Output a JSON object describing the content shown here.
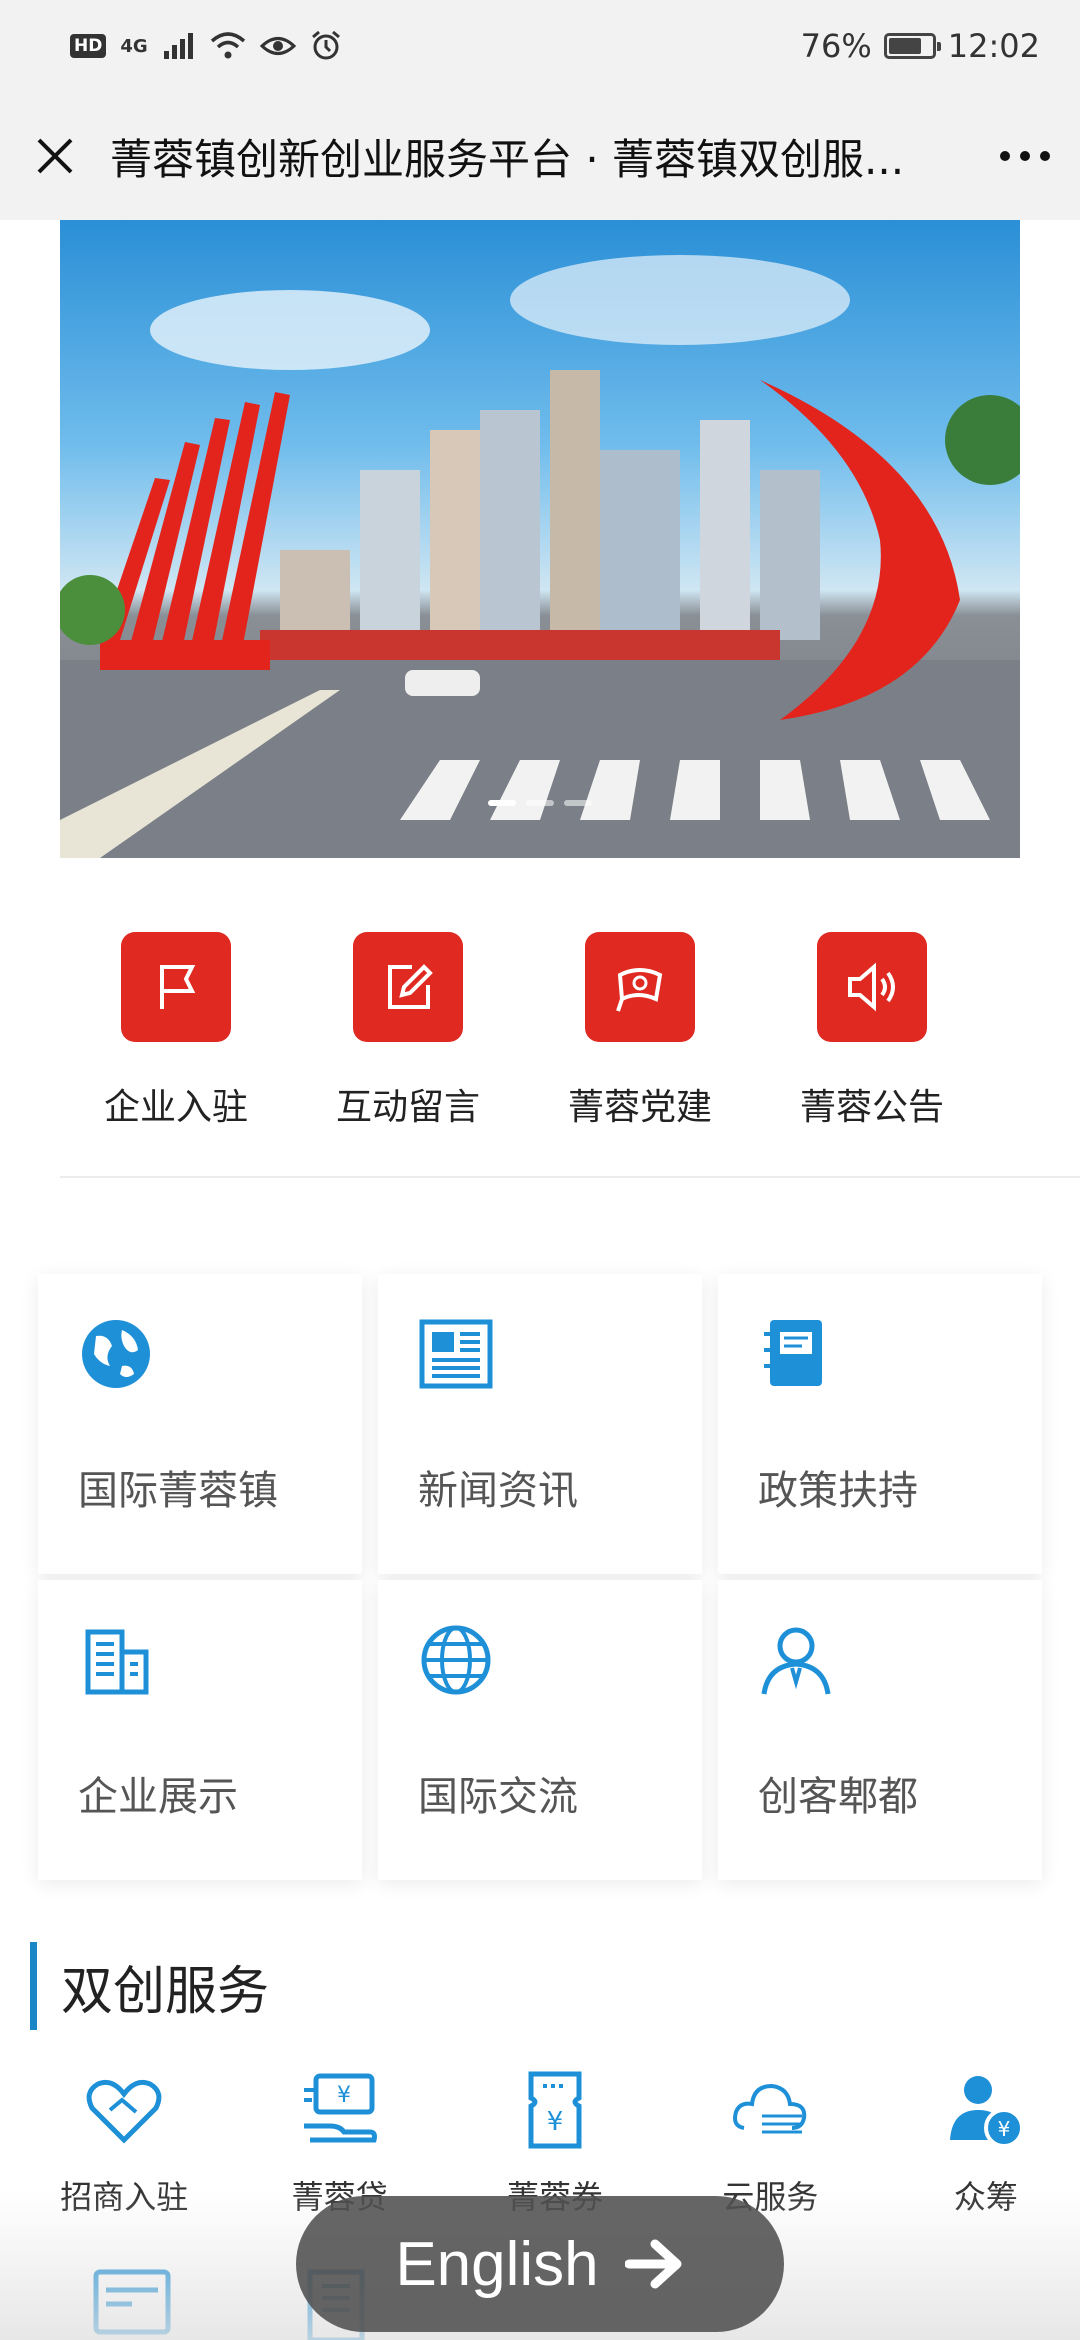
{
  "status_bar": {
    "hd": "HD",
    "network": "4G",
    "battery_percent": "76%",
    "time": "12:02",
    "battery_level": 0.76
  },
  "title_bar": {
    "title": "菁蓉镇创新创业服务平台 · 菁蓉镇双创服..."
  },
  "banner": {
    "slide_count": 3,
    "active_slide": 1
  },
  "quick_menu": [
    {
      "label": "企业入驻",
      "icon": "flag-icon"
    },
    {
      "label": "互动留言",
      "icon": "edit-icon"
    },
    {
      "label": "菁蓉党建",
      "icon": "party-flag-icon"
    },
    {
      "label": "菁蓉公告",
      "icon": "speaker-icon"
    }
  ],
  "grid": [
    {
      "label": "国际菁蓉镇",
      "icon": "earth-icon"
    },
    {
      "label": "新闻资讯",
      "icon": "newspaper-icon"
    },
    {
      "label": "政策扶持",
      "icon": "notebook-icon"
    },
    {
      "label": "企业展示",
      "icon": "building-icon"
    },
    {
      "label": "国际交流",
      "icon": "globe-icon"
    },
    {
      "label": "创客郫都",
      "icon": "person-icon"
    }
  ],
  "section": {
    "title": "双创服务"
  },
  "services": [
    {
      "label": "招商入驻",
      "icon": "handshake-heart-icon"
    },
    {
      "label": "菁蓉贷",
      "icon": "money-hand-icon"
    },
    {
      "label": "菁蓉券",
      "icon": "coupon-icon"
    },
    {
      "label": "云服务",
      "icon": "cloud-icon"
    },
    {
      "label": "众筹",
      "icon": "crowdfunding-icon"
    }
  ],
  "english_button": {
    "label": "English"
  },
  "colors": {
    "accent_red": "#e02a21",
    "accent_blue": "#1a86c6",
    "icon_blue": "#1e90d8"
  }
}
